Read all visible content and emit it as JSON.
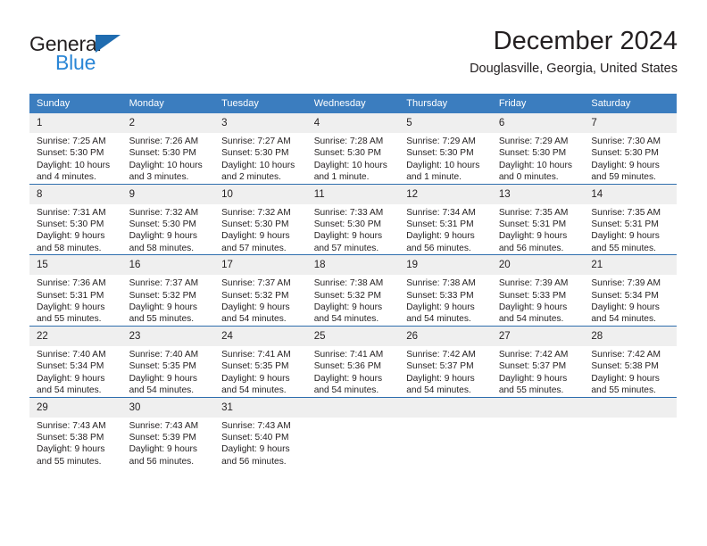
{
  "brand": {
    "logo_text_top": "General",
    "logo_text_bottom": "Blue",
    "logo_triangle_icon": "triangle-icon",
    "accent_blue": "#3b7dbf",
    "logo_blue": "#2a86d6"
  },
  "header": {
    "title": "December 2024",
    "subtitle": "Douglasville, Georgia, United States"
  },
  "calendar": {
    "weekday_headers": [
      "Sunday",
      "Monday",
      "Tuesday",
      "Wednesday",
      "Thursday",
      "Friday",
      "Saturday"
    ],
    "labels": {
      "sunrise": "Sunrise:",
      "sunset": "Sunset:",
      "daylight": "Daylight:"
    },
    "weeks": [
      [
        {
          "day": "1",
          "sunrise": "Sunrise: 7:25 AM",
          "sunset": "Sunset: 5:30 PM",
          "daylight_1": "Daylight: 10 hours",
          "daylight_2": "and 4 minutes."
        },
        {
          "day": "2",
          "sunrise": "Sunrise: 7:26 AM",
          "sunset": "Sunset: 5:30 PM",
          "daylight_1": "Daylight: 10 hours",
          "daylight_2": "and 3 minutes."
        },
        {
          "day": "3",
          "sunrise": "Sunrise: 7:27 AM",
          "sunset": "Sunset: 5:30 PM",
          "daylight_1": "Daylight: 10 hours",
          "daylight_2": "and 2 minutes."
        },
        {
          "day": "4",
          "sunrise": "Sunrise: 7:28 AM",
          "sunset": "Sunset: 5:30 PM",
          "daylight_1": "Daylight: 10 hours",
          "daylight_2": "and 1 minute."
        },
        {
          "day": "5",
          "sunrise": "Sunrise: 7:29 AM",
          "sunset": "Sunset: 5:30 PM",
          "daylight_1": "Daylight: 10 hours",
          "daylight_2": "and 1 minute."
        },
        {
          "day": "6",
          "sunrise": "Sunrise: 7:29 AM",
          "sunset": "Sunset: 5:30 PM",
          "daylight_1": "Daylight: 10 hours",
          "daylight_2": "and 0 minutes."
        },
        {
          "day": "7",
          "sunrise": "Sunrise: 7:30 AM",
          "sunset": "Sunset: 5:30 PM",
          "daylight_1": "Daylight: 9 hours",
          "daylight_2": "and 59 minutes."
        }
      ],
      [
        {
          "day": "8",
          "sunrise": "Sunrise: 7:31 AM",
          "sunset": "Sunset: 5:30 PM",
          "daylight_1": "Daylight: 9 hours",
          "daylight_2": "and 58 minutes."
        },
        {
          "day": "9",
          "sunrise": "Sunrise: 7:32 AM",
          "sunset": "Sunset: 5:30 PM",
          "daylight_1": "Daylight: 9 hours",
          "daylight_2": "and 58 minutes."
        },
        {
          "day": "10",
          "sunrise": "Sunrise: 7:32 AM",
          "sunset": "Sunset: 5:30 PM",
          "daylight_1": "Daylight: 9 hours",
          "daylight_2": "and 57 minutes."
        },
        {
          "day": "11",
          "sunrise": "Sunrise: 7:33 AM",
          "sunset": "Sunset: 5:30 PM",
          "daylight_1": "Daylight: 9 hours",
          "daylight_2": "and 57 minutes."
        },
        {
          "day": "12",
          "sunrise": "Sunrise: 7:34 AM",
          "sunset": "Sunset: 5:31 PM",
          "daylight_1": "Daylight: 9 hours",
          "daylight_2": "and 56 minutes."
        },
        {
          "day": "13",
          "sunrise": "Sunrise: 7:35 AM",
          "sunset": "Sunset: 5:31 PM",
          "daylight_1": "Daylight: 9 hours",
          "daylight_2": "and 56 minutes."
        },
        {
          "day": "14",
          "sunrise": "Sunrise: 7:35 AM",
          "sunset": "Sunset: 5:31 PM",
          "daylight_1": "Daylight: 9 hours",
          "daylight_2": "and 55 minutes."
        }
      ],
      [
        {
          "day": "15",
          "sunrise": "Sunrise: 7:36 AM",
          "sunset": "Sunset: 5:31 PM",
          "daylight_1": "Daylight: 9 hours",
          "daylight_2": "and 55 minutes."
        },
        {
          "day": "16",
          "sunrise": "Sunrise: 7:37 AM",
          "sunset": "Sunset: 5:32 PM",
          "daylight_1": "Daylight: 9 hours",
          "daylight_2": "and 55 minutes."
        },
        {
          "day": "17",
          "sunrise": "Sunrise: 7:37 AM",
          "sunset": "Sunset: 5:32 PM",
          "daylight_1": "Daylight: 9 hours",
          "daylight_2": "and 54 minutes."
        },
        {
          "day": "18",
          "sunrise": "Sunrise: 7:38 AM",
          "sunset": "Sunset: 5:32 PM",
          "daylight_1": "Daylight: 9 hours",
          "daylight_2": "and 54 minutes."
        },
        {
          "day": "19",
          "sunrise": "Sunrise: 7:38 AM",
          "sunset": "Sunset: 5:33 PM",
          "daylight_1": "Daylight: 9 hours",
          "daylight_2": "and 54 minutes."
        },
        {
          "day": "20",
          "sunrise": "Sunrise: 7:39 AM",
          "sunset": "Sunset: 5:33 PM",
          "daylight_1": "Daylight: 9 hours",
          "daylight_2": "and 54 minutes."
        },
        {
          "day": "21",
          "sunrise": "Sunrise: 7:39 AM",
          "sunset": "Sunset: 5:34 PM",
          "daylight_1": "Daylight: 9 hours",
          "daylight_2": "and 54 minutes."
        }
      ],
      [
        {
          "day": "22",
          "sunrise": "Sunrise: 7:40 AM",
          "sunset": "Sunset: 5:34 PM",
          "daylight_1": "Daylight: 9 hours",
          "daylight_2": "and 54 minutes."
        },
        {
          "day": "23",
          "sunrise": "Sunrise: 7:40 AM",
          "sunset": "Sunset: 5:35 PM",
          "daylight_1": "Daylight: 9 hours",
          "daylight_2": "and 54 minutes."
        },
        {
          "day": "24",
          "sunrise": "Sunrise: 7:41 AM",
          "sunset": "Sunset: 5:35 PM",
          "daylight_1": "Daylight: 9 hours",
          "daylight_2": "and 54 minutes."
        },
        {
          "day": "25",
          "sunrise": "Sunrise: 7:41 AM",
          "sunset": "Sunset: 5:36 PM",
          "daylight_1": "Daylight: 9 hours",
          "daylight_2": "and 54 minutes."
        },
        {
          "day": "26",
          "sunrise": "Sunrise: 7:42 AM",
          "sunset": "Sunset: 5:37 PM",
          "daylight_1": "Daylight: 9 hours",
          "daylight_2": "and 54 minutes."
        },
        {
          "day": "27",
          "sunrise": "Sunrise: 7:42 AM",
          "sunset": "Sunset: 5:37 PM",
          "daylight_1": "Daylight: 9 hours",
          "daylight_2": "and 55 minutes."
        },
        {
          "day": "28",
          "sunrise": "Sunrise: 7:42 AM",
          "sunset": "Sunset: 5:38 PM",
          "daylight_1": "Daylight: 9 hours",
          "daylight_2": "and 55 minutes."
        }
      ],
      [
        {
          "day": "29",
          "sunrise": "Sunrise: 7:43 AM",
          "sunset": "Sunset: 5:38 PM",
          "daylight_1": "Daylight: 9 hours",
          "daylight_2": "and 55 minutes."
        },
        {
          "day": "30",
          "sunrise": "Sunrise: 7:43 AM",
          "sunset": "Sunset: 5:39 PM",
          "daylight_1": "Daylight: 9 hours",
          "daylight_2": "and 56 minutes."
        },
        {
          "day": "31",
          "sunrise": "Sunrise: 7:43 AM",
          "sunset": "Sunset: 5:40 PM",
          "daylight_1": "Daylight: 9 hours",
          "daylight_2": "and 56 minutes."
        },
        {
          "day": "",
          "sunrise": "",
          "sunset": "",
          "daylight_1": "",
          "daylight_2": ""
        },
        {
          "day": "",
          "sunrise": "",
          "sunset": "",
          "daylight_1": "",
          "daylight_2": ""
        },
        {
          "day": "",
          "sunrise": "",
          "sunset": "",
          "daylight_1": "",
          "daylight_2": ""
        },
        {
          "day": "",
          "sunrise": "",
          "sunset": "",
          "daylight_1": "",
          "daylight_2": ""
        }
      ]
    ]
  }
}
